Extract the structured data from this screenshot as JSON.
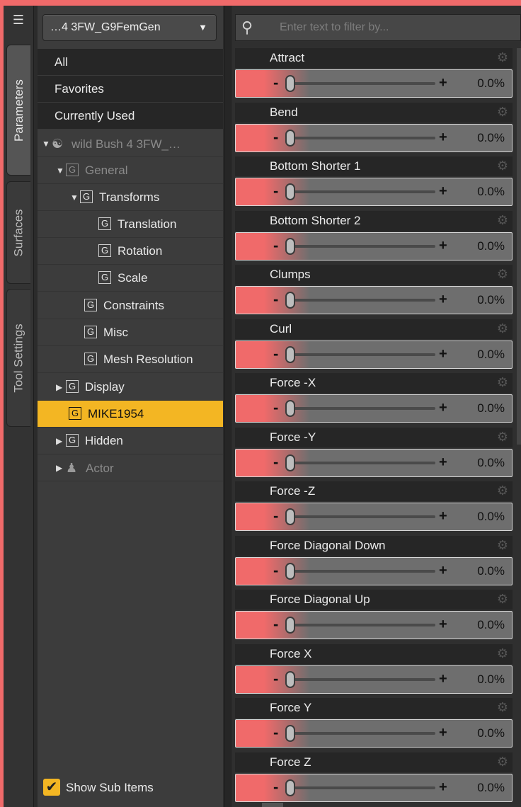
{
  "vtabs": {
    "menu_icon": "pane-menu-icon",
    "tabs": [
      "Parameters",
      "Surfaces",
      "Tool Settings"
    ]
  },
  "tree": {
    "node_selector": "…4 3FW_G9FemGen",
    "top_items": [
      "All",
      "Favorites",
      "Currently Used"
    ],
    "items": [
      {
        "label": "wild Bush 4 3FW_…",
        "icon": "figure-icon"
      },
      {
        "label": "General",
        "icon": "group-icon"
      },
      {
        "label": "Transforms",
        "icon": "group-icon"
      },
      {
        "label": "Translation",
        "icon": "group-icon"
      },
      {
        "label": "Rotation",
        "icon": "group-icon"
      },
      {
        "label": "Scale",
        "icon": "group-icon"
      },
      {
        "label": "Constraints",
        "icon": "group-icon"
      },
      {
        "label": "Misc",
        "icon": "group-icon"
      },
      {
        "label": "Mesh Resolution",
        "icon": "group-icon"
      },
      {
        "label": "Display",
        "icon": "group-icon"
      },
      {
        "label": "MIKE1954",
        "icon": "group-icon"
      },
      {
        "label": "Hidden",
        "icon": "group-icon"
      },
      {
        "label": "Actor",
        "icon": "person-icon"
      }
    ],
    "group_glyph": "G",
    "show_sub_items": "Show Sub Items",
    "selected_color": "#f3b623"
  },
  "filter": {
    "placeholder": "Enter text to filter by..."
  },
  "params": [
    {
      "label": "Attract",
      "value": "0.0%"
    },
    {
      "label": "Bend",
      "value": "0.0%"
    },
    {
      "label": "Bottom Shorter 1",
      "value": "0.0%"
    },
    {
      "label": "Bottom Shorter 2",
      "value": "0.0%"
    },
    {
      "label": "Clumps",
      "value": "0.0%"
    },
    {
      "label": "Curl",
      "value": "0.0%"
    },
    {
      "label": "Force -X",
      "value": "0.0%"
    },
    {
      "label": "Force -Y",
      "value": "0.0%"
    },
    {
      "label": "Force -Z",
      "value": "0.0%"
    },
    {
      "label": "Force Diagonal Down",
      "value": "0.0%"
    },
    {
      "label": "Force Diagonal Up",
      "value": "0.0%"
    },
    {
      "label": "Force X",
      "value": "0.0%"
    },
    {
      "label": "Force Y",
      "value": "0.0%"
    },
    {
      "label": "Force Z",
      "value": "0.0%"
    }
  ],
  "colors": {
    "accent_pink": "#f06a6a",
    "highlight_yellow": "#f3b623"
  }
}
